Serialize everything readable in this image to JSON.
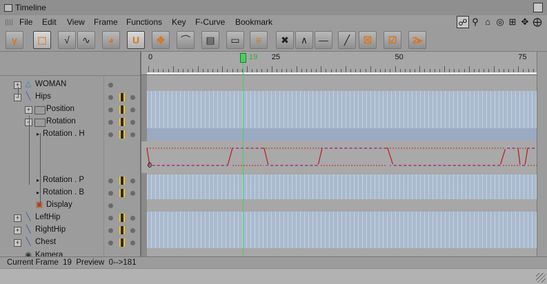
{
  "window": {
    "title": "Timeline"
  },
  "menu": [
    "File",
    "Edit",
    "View",
    "Frame",
    "Functions",
    "Key",
    "F-Curve",
    "Bookmark"
  ],
  "right_icons": [
    "link-icon",
    "magnify-icon",
    "home-icon",
    "eye-icon",
    "frame-plus-icon",
    "move-icon",
    "zoom-icon"
  ],
  "toolbar": [
    {
      "name": "key-mode-button",
      "glyph": "γ",
      "active": false,
      "orange": true
    },
    {
      "name": "select-mode-button",
      "glyph": "⬚",
      "active": true,
      "orange": true
    },
    {
      "name": "curve-mode-button",
      "glyph": "√",
      "active": false,
      "orange": false
    },
    {
      "name": "fcurve-mode-button",
      "glyph": "∿",
      "active": false,
      "orange": false
    },
    {
      "name": "record-button",
      "glyph": "◕",
      "active": false,
      "orange": true
    },
    {
      "name": "magnet-button",
      "glyph": "U",
      "active": true,
      "orange": true
    },
    {
      "name": "move-key-button",
      "glyph": "✥",
      "active": false,
      "orange": true
    },
    {
      "name": "ease-button",
      "glyph": "⌒",
      "active": false,
      "orange": false
    },
    {
      "name": "layer-button",
      "glyph": "▤",
      "active": false,
      "orange": false
    },
    {
      "name": "region-button",
      "glyph": "▭",
      "active": false,
      "orange": false
    },
    {
      "name": "ruler-button",
      "glyph": "≡",
      "active": false,
      "orange": true
    },
    {
      "name": "spline-button",
      "glyph": "✖",
      "active": false,
      "orange": false
    },
    {
      "name": "peak-button",
      "glyph": "∧",
      "active": false,
      "orange": false
    },
    {
      "name": "flat-button",
      "glyph": "—",
      "active": false,
      "orange": false
    },
    {
      "name": "linear-button",
      "glyph": "╱",
      "active": false,
      "orange": false
    },
    {
      "name": "remove-key-button",
      "glyph": "☒",
      "active": false,
      "orange": true
    },
    {
      "name": "confirm-key-button",
      "glyph": "☑",
      "active": false,
      "orange": true
    },
    {
      "name": "record-2-button",
      "glyph": "2▸",
      "active": false,
      "orange": true
    }
  ],
  "ruler": {
    "labels": [
      "0",
      "25",
      "50",
      "75"
    ],
    "current_frame_label": "19"
  },
  "tree": [
    {
      "label": "WOMAN",
      "indent": 1,
      "expander": "+",
      "icon": "figure-icon",
      "film": false,
      "dot2": false
    },
    {
      "label": "Hips",
      "indent": 1,
      "expander": "−",
      "icon": "bone-icon",
      "film": true,
      "dot2": true
    },
    {
      "label": "Position",
      "indent": 2,
      "expander": "+",
      "icon": "folder-icon",
      "film": true,
      "dot2": true
    },
    {
      "label": "Rotation",
      "indent": 2,
      "expander": "−",
      "icon": "open-folder-icon",
      "film": true,
      "dot2": true
    },
    {
      "label": "Rotation . H",
      "indent": 3,
      "expander": "",
      "icon": "",
      "film": true,
      "dot2": true
    },
    {
      "label": "Rotation . P",
      "indent": 3,
      "expander": "",
      "icon": "",
      "film": true,
      "dot2": true
    },
    {
      "label": "Rotation . B",
      "indent": 3,
      "expander": "",
      "icon": "",
      "film": true,
      "dot2": true
    },
    {
      "label": "Display",
      "indent": 2,
      "expander": "",
      "icon": "display-icon",
      "film": false,
      "dot2": false
    },
    {
      "label": "LeftHip",
      "indent": 1,
      "expander": "+",
      "icon": "bone-icon",
      "film": true,
      "dot2": true
    },
    {
      "label": "RightHip",
      "indent": 1,
      "expander": "+",
      "icon": "bone-icon",
      "film": true,
      "dot2": true
    },
    {
      "label": "Chest",
      "indent": 1,
      "expander": "+",
      "icon": "bone-icon",
      "film": true,
      "dot2": true
    },
    {
      "label": "Kamera",
      "indent": 0,
      "expander": "",
      "icon": "camera-icon",
      "film": false,
      "dot2": false
    }
  ],
  "curve": {
    "top_label": "",
    "zero_label": "0"
  },
  "status": {
    "text": "Current Frame  19  Preview  0-->181"
  }
}
